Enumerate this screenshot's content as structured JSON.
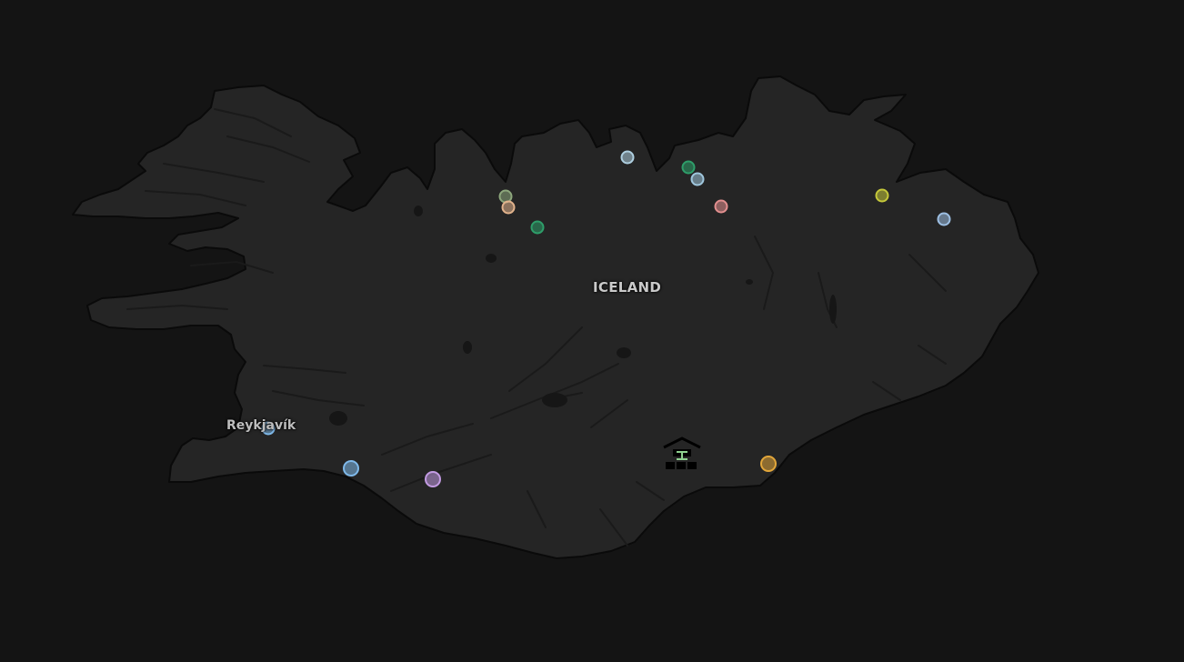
{
  "map": {
    "country_label": "ICELAND",
    "capital_label": "Reykjavík",
    "land_color": "#252525",
    "sea_color": "#141414",
    "coast_color": "#0a0a0a"
  },
  "markers": [
    {
      "id": "marker-1",
      "color": "#aecfe0",
      "icon": "circle-marker"
    },
    {
      "id": "marker-2",
      "color": "#2e9e6a",
      "icon": "circle-marker"
    },
    {
      "id": "marker-3",
      "color": "#9fc6dd",
      "icon": "circle-marker"
    },
    {
      "id": "marker-4",
      "color": "#e38f8f",
      "icon": "circle-marker"
    },
    {
      "id": "marker-5",
      "color": "#8da77c",
      "icon": "circle-marker"
    },
    {
      "id": "marker-6",
      "color": "#e2b38c",
      "icon": "circle-marker"
    },
    {
      "id": "marker-7",
      "color": "#2e9e6a",
      "icon": "circle-marker"
    },
    {
      "id": "marker-8",
      "color": "#c5c83a",
      "icon": "circle-marker"
    },
    {
      "id": "marker-9",
      "color": "#9dbfe3",
      "icon": "circle-marker"
    },
    {
      "id": "marker-10",
      "color": "#7fb9ea",
      "icon": "circle-marker"
    },
    {
      "id": "marker-11",
      "color": "#c39be3",
      "icon": "circle-marker"
    },
    {
      "id": "marker-12",
      "color": "#e2a63a",
      "icon": "circle-marker"
    },
    {
      "id": "marker-13",
      "color": "#7fb9ea",
      "icon": "circle-marker"
    }
  ],
  "hut_icon": {
    "icon": "mountain-hut-icon",
    "accent": "#8ecf8e"
  }
}
